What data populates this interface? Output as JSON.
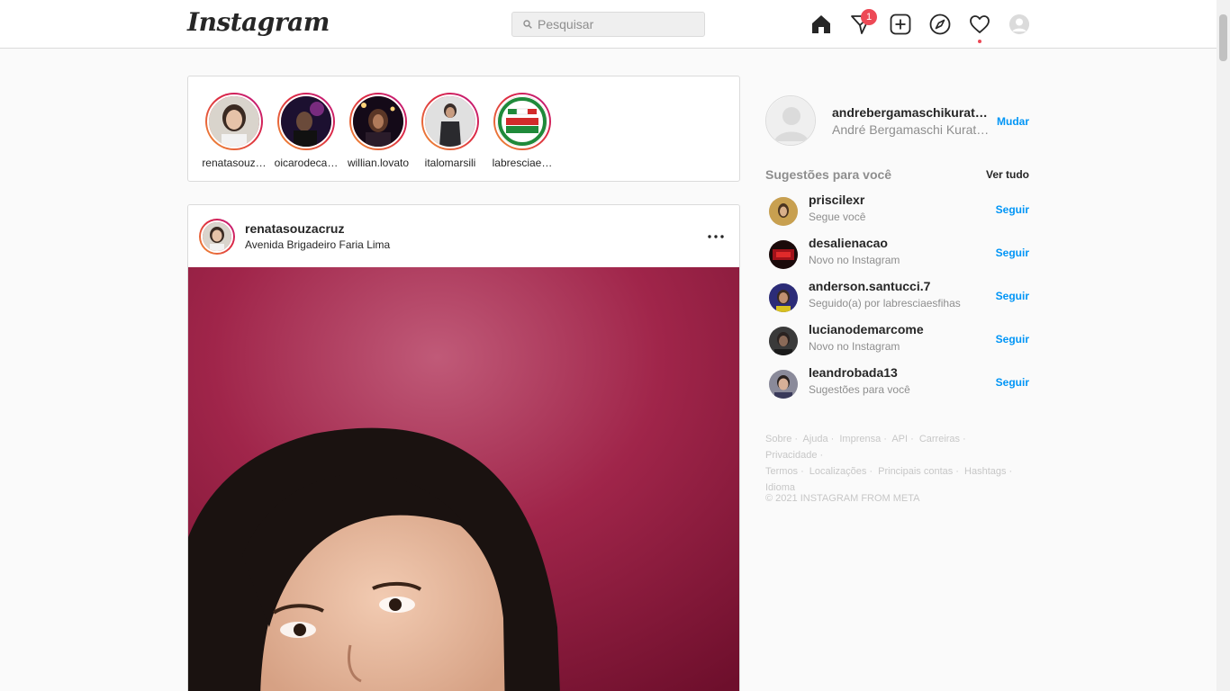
{
  "header": {
    "logo": "Instagram",
    "search_placeholder": "Pesquisar",
    "messages_badge": "1"
  },
  "stories": [
    {
      "username": "renatasouz…",
      "icon": "avatar-woman"
    },
    {
      "username": "oicarodeca…",
      "icon": "avatar-stage"
    },
    {
      "username": "willian.lovato",
      "icon": "avatar-concert"
    },
    {
      "username": "italomarsili",
      "icon": "avatar-man-suit"
    },
    {
      "username": "labresciae…",
      "icon": "logo-la-brescia-esfihas"
    }
  ],
  "post": {
    "username": "renatasouzacruz",
    "location": "Avenida Brigadeiro Faria Lima"
  },
  "sidebar": {
    "me": {
      "username": "andrebergamaschikurat…",
      "full_name": "André Bergamaschi Kurat…",
      "switch_label": "Mudar"
    },
    "suggestions_title": "Sugestões para você",
    "see_all": "Ver tudo",
    "suggestions": [
      {
        "username": "priscilexr",
        "subtitle": "Segue você",
        "action": "Seguir",
        "avatar_color": "#b08a3c"
      },
      {
        "username": "desalienacao",
        "subtitle": "Novo no Instagram",
        "action": "Seguir",
        "avatar_color": "#8b0f15"
      },
      {
        "username": "anderson.santucci.7",
        "subtitle": "Seguido(a) por labresciaesfihas",
        "action": "Seguir",
        "avatar_color": "#3a3a8a"
      },
      {
        "username": "lucianodemarcome",
        "subtitle": "Novo no Instagram",
        "action": "Seguir",
        "avatar_color": "#4a4a4a"
      },
      {
        "username": "leandrobada13",
        "subtitle": "Sugestões para você",
        "action": "Seguir",
        "avatar_color": "#6b5a52"
      }
    ],
    "footer_links": [
      "Sobre",
      "Ajuda",
      "Imprensa",
      "API",
      "Carreiras",
      "Privacidade",
      "Termos",
      "Localizações",
      "Principais contas",
      "Hashtags",
      "Idioma"
    ],
    "copyright": "© 2021 INSTAGRAM FROM META"
  },
  "colors": {
    "accent": "#0095f6",
    "badge": "#ed4956",
    "border": "#dbdbdb"
  }
}
